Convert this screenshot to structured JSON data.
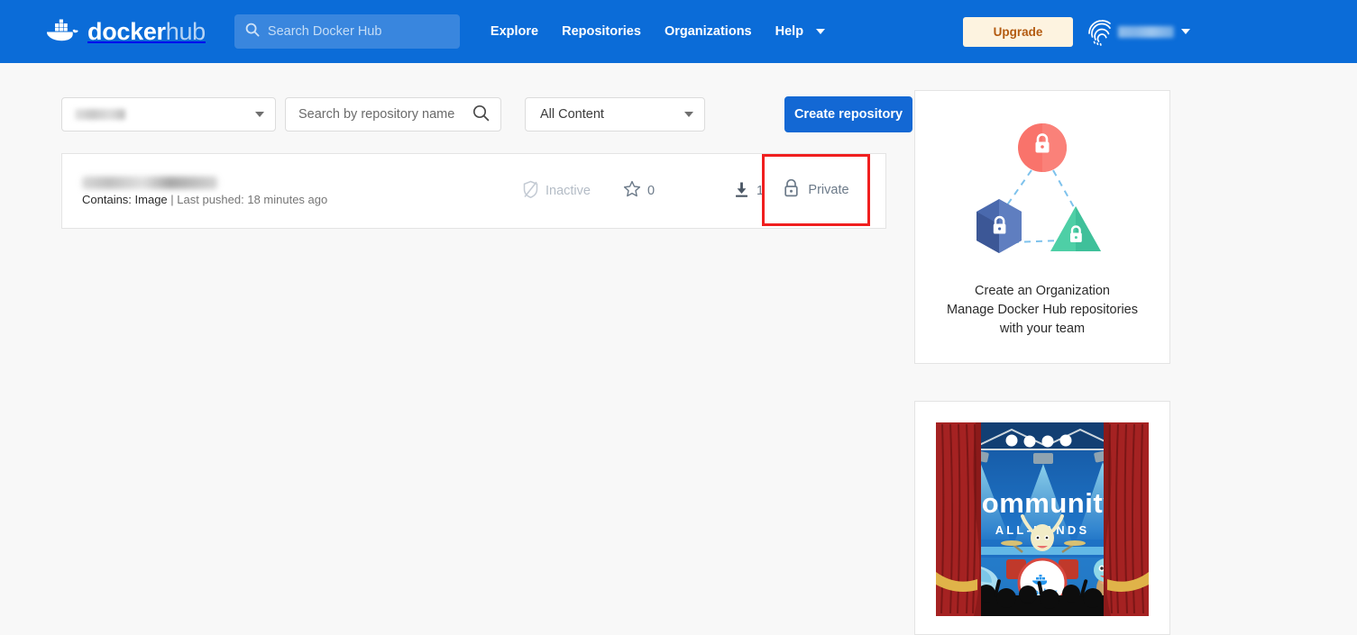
{
  "header": {
    "logo": {
      "icon": "docker-whale-logo",
      "brand": "docker",
      "product": "hub"
    },
    "search": {
      "placeholder": "Search Docker Hub",
      "icon": "search-icon",
      "value": ""
    },
    "nav": [
      {
        "label": "Explore",
        "name": "explore"
      },
      {
        "label": "Repositories",
        "name": "repositories"
      },
      {
        "label": "Organizations",
        "name": "organizations"
      },
      {
        "label": "Help",
        "name": "help"
      }
    ],
    "help_caret_icon": "chevron-down-icon",
    "upgrade_label": "Upgrade",
    "avatar_icon": "fingerprint-avatar-icon",
    "username": "",
    "user_caret_icon": "chevron-down-icon"
  },
  "filters": {
    "namespace_value": "",
    "namespace_caret_icon": "chevron-down-icon",
    "repo_search_placeholder": "Search by repository name",
    "repo_search_value": "",
    "repo_search_icon": "search-icon",
    "content_value": "All Content",
    "content_caret_icon": "chevron-down-icon",
    "create_repo_label": "Create repository"
  },
  "repositories": [
    {
      "name": "",
      "meta_contains": "Contains: Image",
      "meta_separator": " | ",
      "meta_pushed": "Last pushed: 18 minutes ago",
      "scan_status": "Inactive",
      "scan_icon": "shield-disabled-icon",
      "stars": "0",
      "star_icon": "star-outline-icon",
      "pulls": "1",
      "pull_icon": "download-icon",
      "visibility": "Private",
      "visibility_icon": "lock-icon",
      "highlight_color": "#f01f1f"
    }
  ],
  "sidebar": {
    "org_card": {
      "illustration": "organization-lock-shapes-illustration",
      "line1": "Create an Organization",
      "line2": "Manage Docker Hub repositories",
      "line3": "with your team"
    },
    "community_card": {
      "banner": "community-all-hands-banner",
      "banner_title": "community",
      "banner_subtitle": "ALL-HANDS",
      "drum_logo_label": "docker"
    }
  },
  "colors": {
    "header_blue": "#0b6cd8",
    "primary_button": "#1368d4",
    "upgrade_bg": "#fdf3e0",
    "upgrade_text": "#b35a10",
    "page_bg": "#f8f8f8",
    "annotation_red": "#f01f1f"
  }
}
